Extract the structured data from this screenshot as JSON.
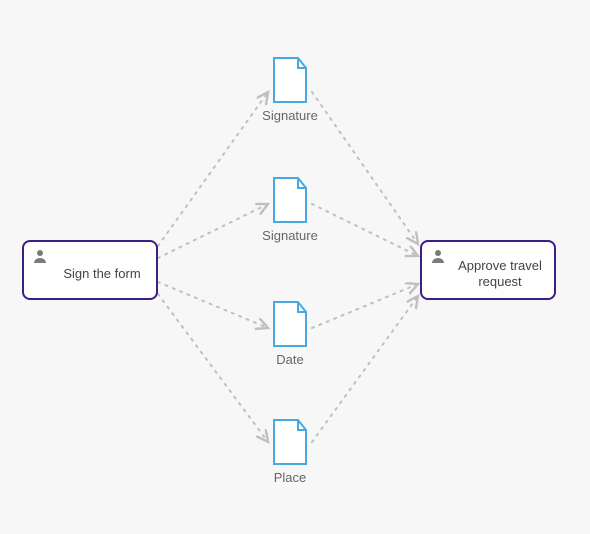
{
  "tasks": {
    "left": {
      "label": "Sign the form"
    },
    "right": {
      "label": "Approve travel request"
    }
  },
  "documents": {
    "d1": {
      "label": "Signature"
    },
    "d2": {
      "label": "Signature"
    },
    "d3": {
      "label": "Date"
    },
    "d4": {
      "label": "Place"
    }
  },
  "colors": {
    "node_border": "#3b1e87",
    "doc_stroke": "#4aa8e0",
    "edge": "#bfbfbf",
    "user_icon": "#7a7a7a"
  }
}
